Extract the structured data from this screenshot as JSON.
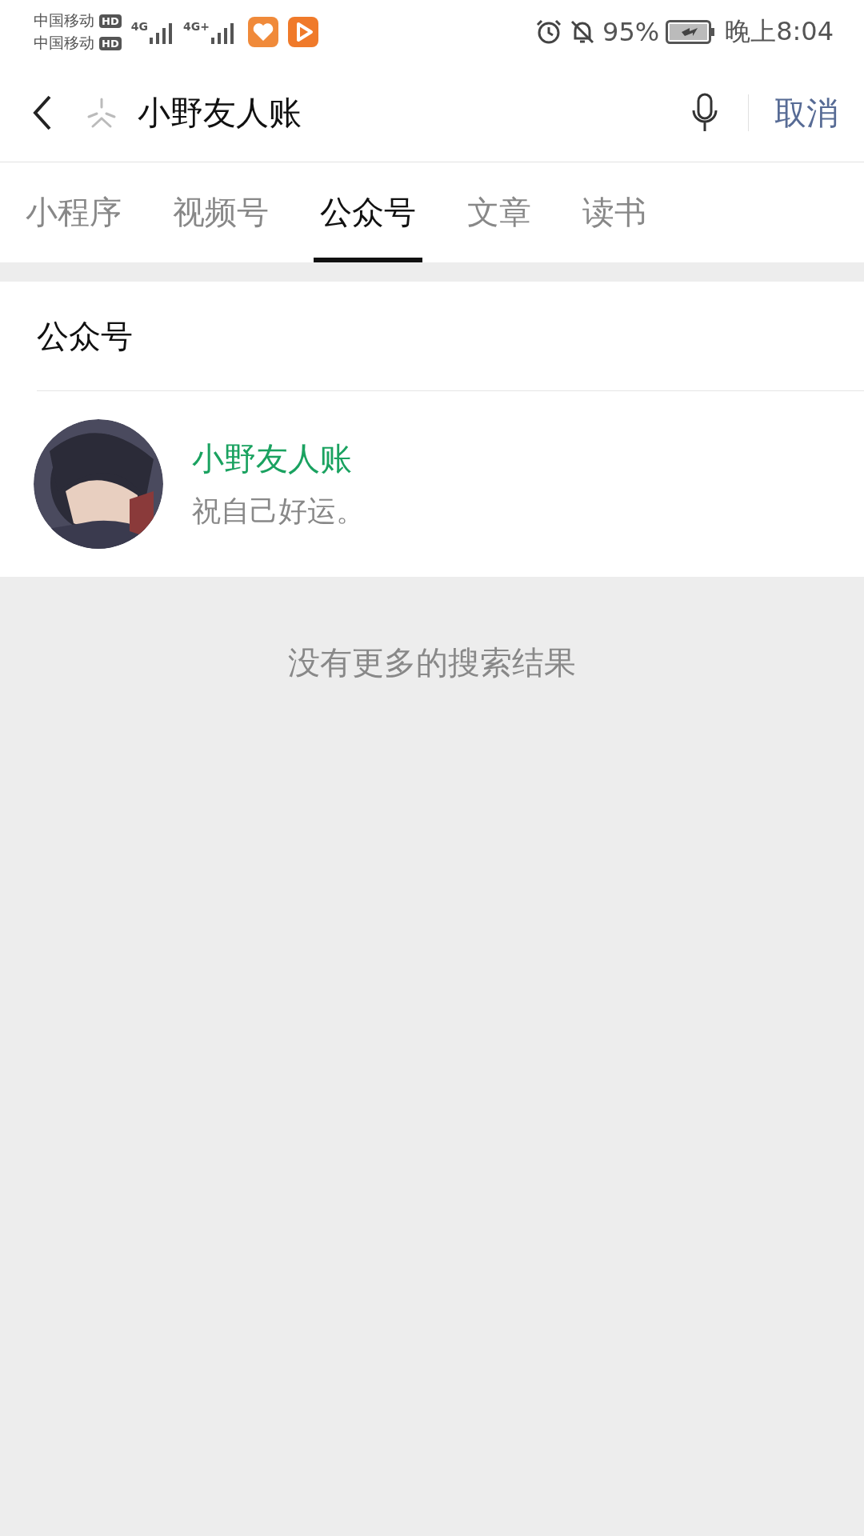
{
  "status_bar": {
    "carriers": [
      {
        "name": "中国移动",
        "badge": "HD"
      },
      {
        "name": "中国移动",
        "badge": "HD"
      }
    ],
    "networks": [
      "4G",
      "4G+"
    ],
    "battery": "95%",
    "time": "晚上8:04"
  },
  "search": {
    "value": "小野友人账",
    "cancel": "取消"
  },
  "tabs": [
    {
      "label": "小程序",
      "selected": false
    },
    {
      "label": "视频号",
      "selected": false
    },
    {
      "label": "公众号",
      "selected": true
    },
    {
      "label": "文章",
      "selected": false
    },
    {
      "label": "读书",
      "selected": false
    }
  ],
  "section": {
    "title": "公众号",
    "results": [
      {
        "name": "小野友人账",
        "description": "祝自己好运。"
      }
    ]
  },
  "footer": "没有更多的搜索结果"
}
